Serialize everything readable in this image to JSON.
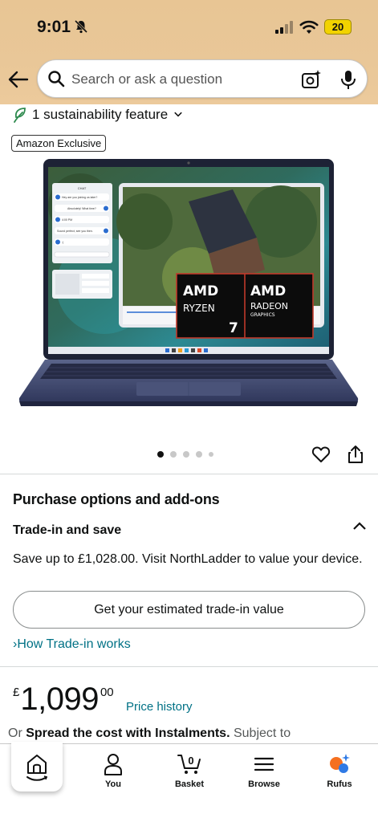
{
  "status_bar": {
    "time": "9:01",
    "battery": "20"
  },
  "search": {
    "placeholder": "Search or ask a question"
  },
  "sustainability": {
    "label": "1 sustainability feature"
  },
  "badge": {
    "label": "Amazon Exclusive"
  },
  "product_image": {
    "screen_chat": {
      "title": "CHAT",
      "messages": [
        "Hey are you joining us later?",
        "Absolutely! What time?",
        "4:00 PM",
        "Sound perfect, see you then.",
        ":)"
      ]
    },
    "logo_left": {
      "brand": "AMD",
      "line1": "RYZEN",
      "line2": "7"
    },
    "logo_right": {
      "brand": "AMD",
      "line1": "RADEON",
      "line2": "GRAPHICS"
    }
  },
  "carousel": {
    "count": 5,
    "active_index": 0
  },
  "purchase": {
    "heading": "Purchase options and add-ons",
    "trade_heading": "Trade-in and save",
    "trade_text": "Save up to £1,028.00. Visit NorthLadder to value your device.",
    "trade_button": "Get your estimated trade-in value",
    "how_link": "How Trade-in works"
  },
  "price": {
    "currency": "£",
    "whole": "1,099",
    "fraction": "00",
    "history_link": "Price history",
    "instal_prefix": "Or",
    "instal_bold": "Spread the cost with Instalments.",
    "instal_suffix": "Subject to"
  },
  "nav": {
    "items": [
      {
        "label": "",
        "icon": "home-icon"
      },
      {
        "label": "You",
        "icon": "person-icon"
      },
      {
        "label": "Basket",
        "icon": "basket-icon",
        "count": "0"
      },
      {
        "label": "Browse",
        "icon": "menu-icon"
      },
      {
        "label": "Rufus",
        "icon": "rufus-icon"
      }
    ]
  },
  "colors": {
    "link": "#007185",
    "header_bg": "#e9c798",
    "battery": "#f2d300",
    "rufus_orange": "#f5701f",
    "rufus_blue": "#2f7ae5"
  }
}
